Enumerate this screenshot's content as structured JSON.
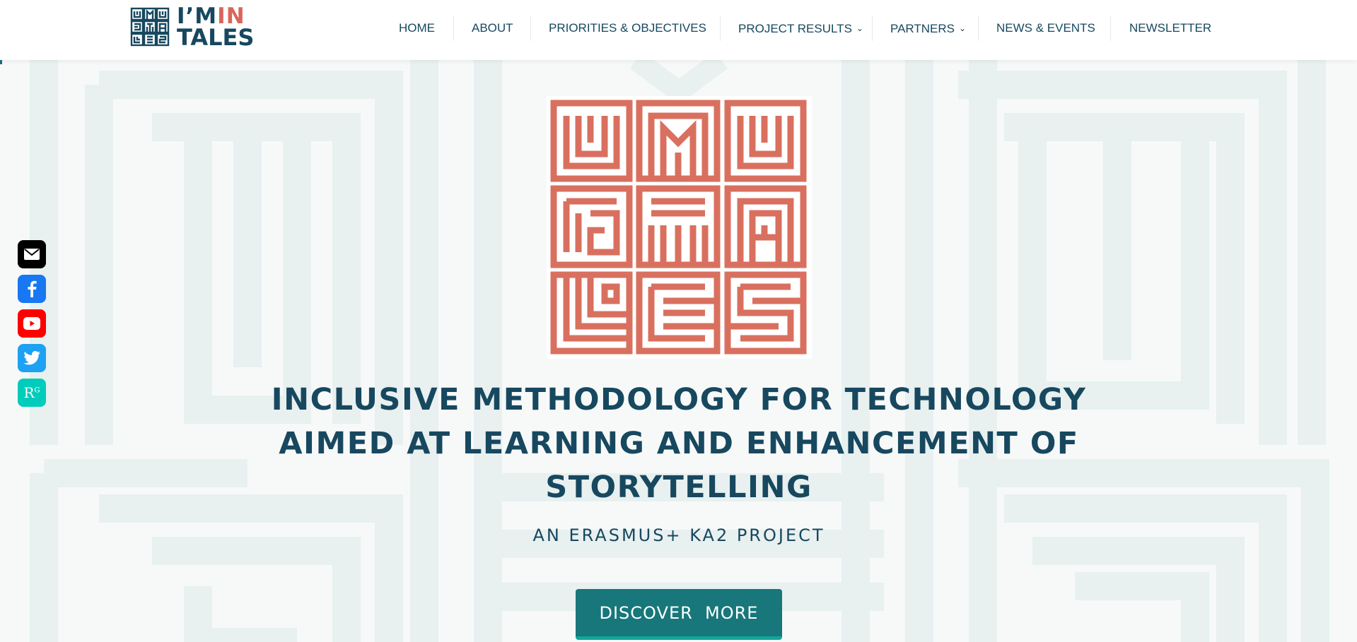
{
  "brand": {
    "line1_a": "I’M",
    "line1_b": "IN",
    "line2": "TALES"
  },
  "nav": {
    "items": [
      {
        "label": "HOME"
      },
      {
        "label": "ABOUT"
      },
      {
        "label": "PRIORITIES & OBJECTIVES"
      },
      {
        "label": "PROJECT RESULTS",
        "has_dropdown": true
      },
      {
        "label": "PARTNERS",
        "has_dropdown": true
      },
      {
        "label": "NEWS & EVENTS"
      },
      {
        "label": "NEWSLETTER"
      }
    ]
  },
  "social": [
    {
      "icon": "envelope-icon",
      "color": "#000000"
    },
    {
      "icon": "facebook-icon",
      "color": "#1877f2"
    },
    {
      "icon": "youtube-icon",
      "color": "#ff0000"
    },
    {
      "icon": "twitter-icon",
      "color": "#1da1f2"
    },
    {
      "icon": "researchgate-icon",
      "color": "#00ccbb",
      "text": "R",
      "sup": "G"
    }
  ],
  "hero": {
    "title": "INCLUSIVE METHODOLOGY FOR TECHNOLOGY AIMED AT LEARNING AND ENHANCEMENT OF STORYTELLING",
    "subtitle": "AN ERASMUS+ KA2 PROJECT",
    "cta": "DISCOVER  MORE"
  },
  "colors": {
    "primary": "#17485f",
    "accent": "#d9665b",
    "button": "#17777a"
  }
}
